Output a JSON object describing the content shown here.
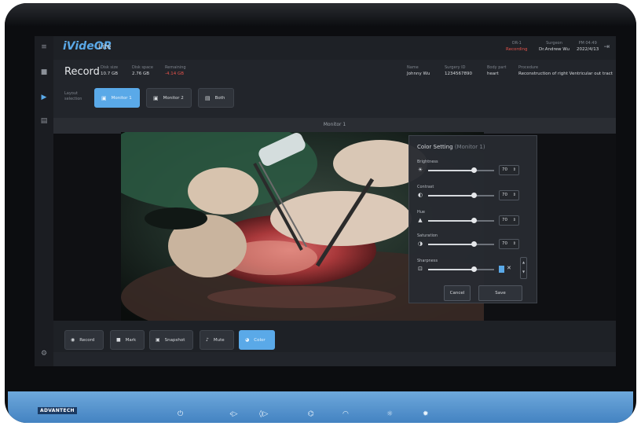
{
  "app": {
    "name": "iVideOR",
    "edition": "Lite"
  },
  "topbar": {
    "or": {
      "label": "OR-1",
      "value": "Recording"
    },
    "surgeon": {
      "label": "Surgeon",
      "value": "Dr.Andrew Wu"
    },
    "datetime": {
      "time": "PM 04:49",
      "date": "2022/4/13"
    }
  },
  "record": {
    "title": "Record",
    "total_size": {
      "label": "Disk size",
      "value": "10.7 GB"
    },
    "disk_space": {
      "label": "Disk space",
      "value": "2.76 GB"
    },
    "remaining": {
      "label": "Remaining",
      "value": "-4.14 GB"
    }
  },
  "patient": {
    "name": {
      "label": "Name",
      "value": "Johnny Wu"
    },
    "surgery_id": {
      "label": "Surgery ID",
      "value": "1234567890"
    },
    "body_part": {
      "label": "Body part",
      "value": "heart"
    },
    "procedure": {
      "label": "Procedure",
      "value": "Reconstruction of right Ventricular out tract"
    }
  },
  "layout": {
    "label": "Layout selection",
    "options": [
      "Monitor 1",
      "Monitor 2",
      "Both"
    ],
    "selected": "Monitor 1"
  },
  "viewer": {
    "title": "Monitor 1"
  },
  "color_setting": {
    "title": "Color Setting",
    "monitor": "(Monitor 1)",
    "rows": [
      {
        "label": "Brightness",
        "value": "70",
        "level": 0.7,
        "icon": "sun-icon"
      },
      {
        "label": "Contrast",
        "value": "70",
        "level": 0.7,
        "icon": "contrast-icon"
      },
      {
        "label": "Hue",
        "value": "70",
        "level": 0.7,
        "icon": "hue-icon"
      },
      {
        "label": "Saturation",
        "value": "70",
        "level": 0.7,
        "icon": "saturation-icon"
      },
      {
        "label": "Sharpness",
        "value": "",
        "level": 0.7,
        "icon": "sharpness-icon"
      }
    ],
    "cancel_label": "Cancel",
    "save_label": "Save"
  },
  "actions": [
    {
      "label": "Record",
      "icon": "record-icon"
    },
    {
      "label": "Mark",
      "icon": "bookmark-icon"
    },
    {
      "label": "Snapshot",
      "icon": "camera-icon"
    },
    {
      "label": "Mute",
      "icon": "mic-icon"
    },
    {
      "label": "Color",
      "icon": "palette-icon"
    }
  ],
  "hardware": {
    "brand": "ADVANTECH",
    "buttons": [
      "power-icon",
      "input-prev-icon",
      "input-next-icon",
      "wifi-icon",
      "eye-icon",
      "brightness-down-icon",
      "brightness-up-icon"
    ]
  },
  "colors": {
    "accent": "#5aa9e8",
    "warning": "#e5534b",
    "bezel": "#0c0d10",
    "base": "#4f8fcb"
  }
}
